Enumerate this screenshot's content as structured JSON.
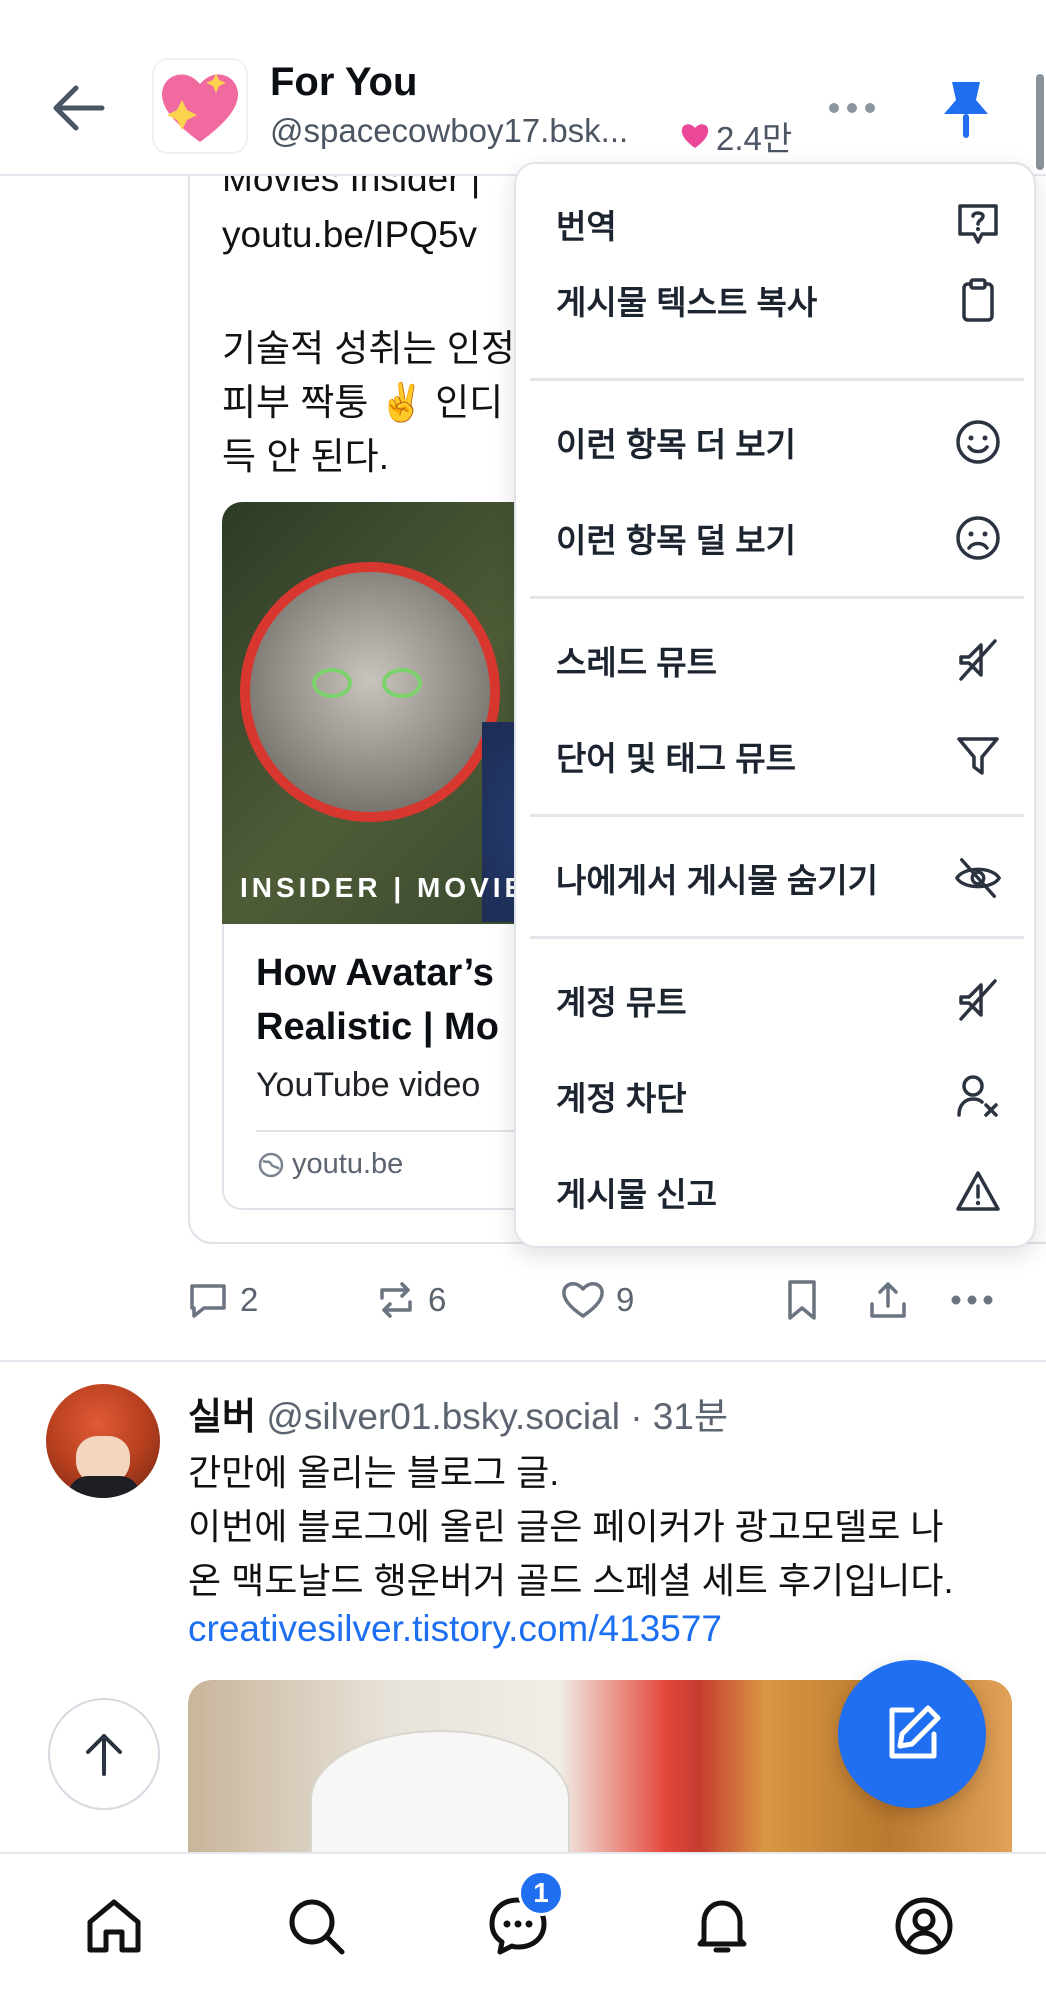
{
  "header": {
    "title": "For You",
    "handle": "@spacecowboy17.bsk...",
    "likes": "2.4만"
  },
  "post1": {
    "lines": [
      "Movies Insider |",
      "youtu.be/IPQ5v",
      "기술적 성취는 인정",
      "피부 짝퉁 ✌️ 인디",
      "득 안 된다."
    ],
    "thumb_brand": "INSIDER | MOVIE",
    "card_title_1": "How Avatar’s",
    "card_title_2": "Realistic | Mo",
    "card_sub": "YouTube video",
    "card_domain": "youtu.be",
    "replies": "2",
    "reposts": "6",
    "likes": "9"
  },
  "menu": {
    "items": [
      {
        "label": "번역",
        "icon": "translate-icon"
      },
      {
        "label": "게시물 텍스트 복사",
        "icon": "clipboard-icon"
      },
      {
        "label": "이런 항목 더 보기",
        "icon": "smile-icon"
      },
      {
        "label": "이런 항목 덜 보기",
        "icon": "frown-icon"
      },
      {
        "label": "스레드 뮤트",
        "icon": "mute-icon"
      },
      {
        "label": "단어 및 태그 뮤트",
        "icon": "filter-icon"
      },
      {
        "label": "나에게서 게시물 숨기기",
        "icon": "eye-off-icon"
      },
      {
        "label": "계정 뮤트",
        "icon": "mute-icon"
      },
      {
        "label": "계정 차단",
        "icon": "user-block-icon"
      },
      {
        "label": "게시물 신고",
        "icon": "warning-icon"
      }
    ]
  },
  "post2": {
    "name": "실버",
    "meta": "@silver01.bsky.social · 31분",
    "line1": "간만에 올리는 블로그 글.",
    "line2": "이번에 블로그에 올린 글은 페이커가 광고모델로 나",
    "line3": "온 맥도날드 행운버거 골드 스페셜 세트 후기입니다.",
    "link": "creativesilver.tistory.com/413577"
  },
  "nav": {
    "chat_badge": "1"
  },
  "colors": {
    "accent": "#1f6ff0",
    "heart": "#ec4899"
  }
}
